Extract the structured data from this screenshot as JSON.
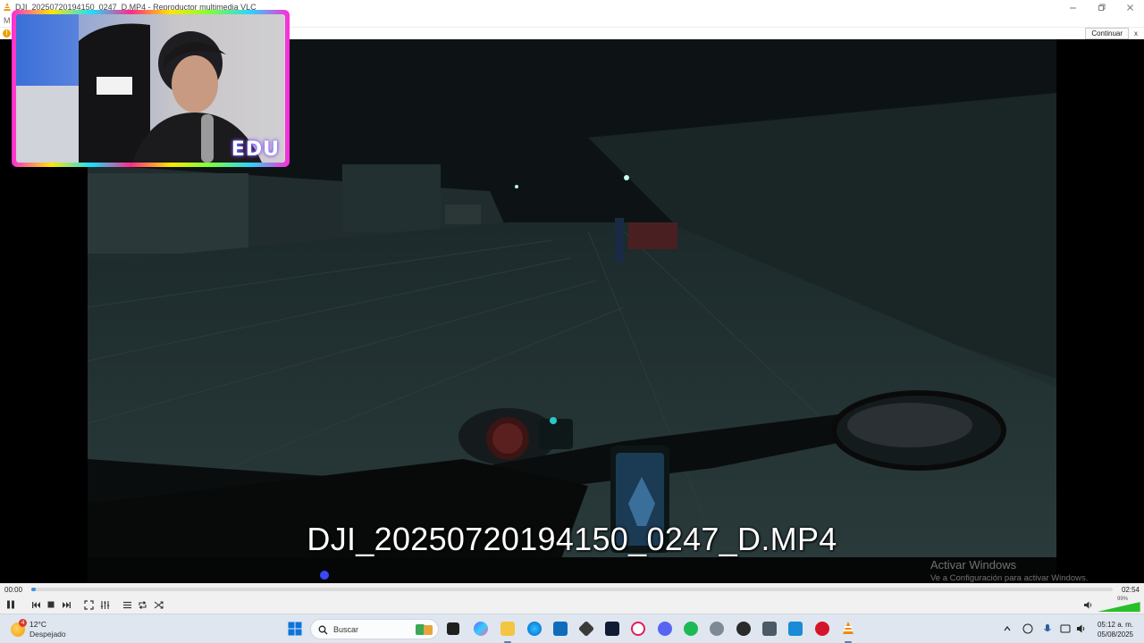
{
  "window": {
    "title": "DJI_20250720194150_0247_D.MP4 - Reproductor multimedia VLC",
    "menu_initial": "M"
  },
  "notice": {
    "continue_label": "Continuar",
    "close_label": "x"
  },
  "video": {
    "subtitle": "DJI_20250720194150_0247_D.MP4",
    "watermark_title": "Activar Windows",
    "watermark_body": "Ve a Configuración para activar Windows."
  },
  "webcam": {
    "logo_text": "EDU"
  },
  "player": {
    "time_elapsed": "00:00",
    "time_total": "02:54",
    "progress_fraction": 0.004,
    "volume_label": "99%",
    "volume_fraction": 0.99,
    "controls": [
      "pause-icon",
      "previous-icon",
      "stop-icon",
      "next-icon",
      "fullscreen-icon",
      "extended-settings-icon",
      "playlist-icon",
      "loop-icon",
      "shuffle-icon"
    ]
  },
  "taskbar": {
    "weather_badge": "4",
    "weather_temp": "12°C",
    "weather_condition": "Despejado",
    "search_placeholder": "Buscar",
    "clock_time": "05:12 a. m.",
    "clock_date": "05/08/2025",
    "accent_color": "#0078d4"
  }
}
